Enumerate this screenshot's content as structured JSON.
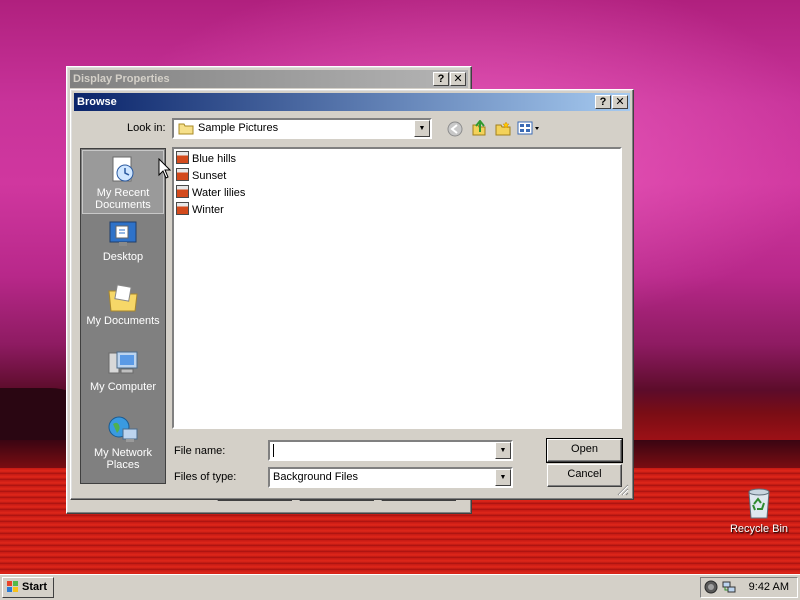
{
  "display_properties": {
    "title": "Display Properties",
    "help": "?",
    "close": "✕"
  },
  "browse": {
    "title": "Browse",
    "help": "?",
    "close": "✕",
    "look_in_label": "Look in:",
    "look_in_value": "Sample Pictures",
    "places": [
      {
        "label": "My Recent Documents",
        "icon": "recent-documents-icon"
      },
      {
        "label": "Desktop",
        "icon": "desktop-icon"
      },
      {
        "label": "My Documents",
        "icon": "my-documents-icon"
      },
      {
        "label": "My Computer",
        "icon": "my-computer-icon"
      },
      {
        "label": "My Network Places",
        "icon": "network-places-icon"
      }
    ],
    "files": [
      "Blue hills",
      "Sunset",
      "Water lilies",
      "Winter"
    ],
    "file_name_label": "File name:",
    "file_name_value": "",
    "files_of_type_label": "Files of type:",
    "files_of_type_value": "Background Files",
    "open_label": "Open",
    "cancel_label": "Cancel"
  },
  "desktop": {
    "recycle_bin_label": "Recycle Bin"
  },
  "taskbar": {
    "start_label": "Start",
    "clock": "9:42 AM"
  }
}
